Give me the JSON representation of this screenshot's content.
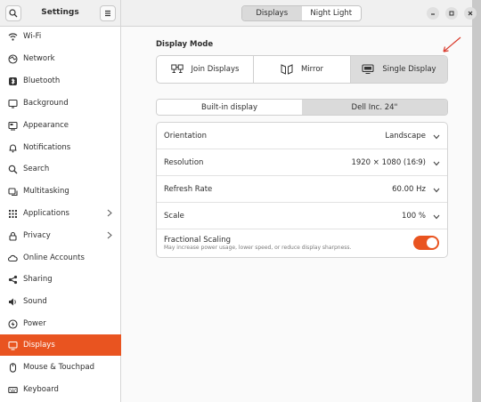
{
  "sidebar": {
    "title": "Settings",
    "items": [
      {
        "label": "Wi-Fi",
        "icon": "wifi-icon"
      },
      {
        "label": "Network",
        "icon": "network-icon"
      },
      {
        "label": "Bluetooth",
        "icon": "bluetooth-icon"
      },
      {
        "label": "Background",
        "icon": "background-icon"
      },
      {
        "label": "Appearance",
        "icon": "appearance-icon"
      },
      {
        "label": "Notifications",
        "icon": "bell-icon"
      },
      {
        "label": "Search",
        "icon": "search-icon"
      },
      {
        "label": "Multitasking",
        "icon": "multitasking-icon"
      },
      {
        "label": "Applications",
        "icon": "applications-icon",
        "has_submenu": true
      },
      {
        "label": "Privacy",
        "icon": "privacy-icon",
        "has_submenu": true
      },
      {
        "label": "Online Accounts",
        "icon": "cloud-icon"
      },
      {
        "label": "Sharing",
        "icon": "share-icon"
      },
      {
        "label": "Sound",
        "icon": "sound-icon"
      },
      {
        "label": "Power",
        "icon": "power-icon"
      },
      {
        "label": "Displays",
        "icon": "display-icon",
        "active": true
      },
      {
        "label": "Mouse & Touchpad",
        "icon": "mouse-icon"
      },
      {
        "label": "Keyboard",
        "icon": "keyboard-icon"
      }
    ]
  },
  "header": {
    "tabs": [
      {
        "label": "Displays",
        "selected": true
      },
      {
        "label": "Night Light",
        "selected": false
      }
    ]
  },
  "display_mode": {
    "label": "Display Mode",
    "options": [
      {
        "label": "Join Displays",
        "icon": "join-displays-icon",
        "selected": false
      },
      {
        "label": "Mirror",
        "icon": "mirror-icon",
        "selected": false
      },
      {
        "label": "Single Display",
        "icon": "single-display-icon",
        "selected": true
      }
    ]
  },
  "monitors": {
    "tabs": [
      {
        "label": "Built-in display",
        "selected": true
      },
      {
        "label": "Dell Inc. 24\"",
        "selected": false
      }
    ]
  },
  "settings": {
    "orientation": {
      "label": "Orientation",
      "value": "Landscape"
    },
    "resolution": {
      "label": "Resolution",
      "value": "1920 × 1080 (16∶9)"
    },
    "refresh_rate": {
      "label": "Refresh Rate",
      "value": "60.00 Hz"
    },
    "scale": {
      "label": "Scale",
      "value": "100 %"
    },
    "fractional_scaling": {
      "label": "Fractional Scaling",
      "description": "May increase power usage, lower speed, or reduce display sharpness.",
      "enabled": true
    }
  },
  "colors": {
    "accent": "#e95420",
    "annotation_arrow": "#d93a2b"
  }
}
